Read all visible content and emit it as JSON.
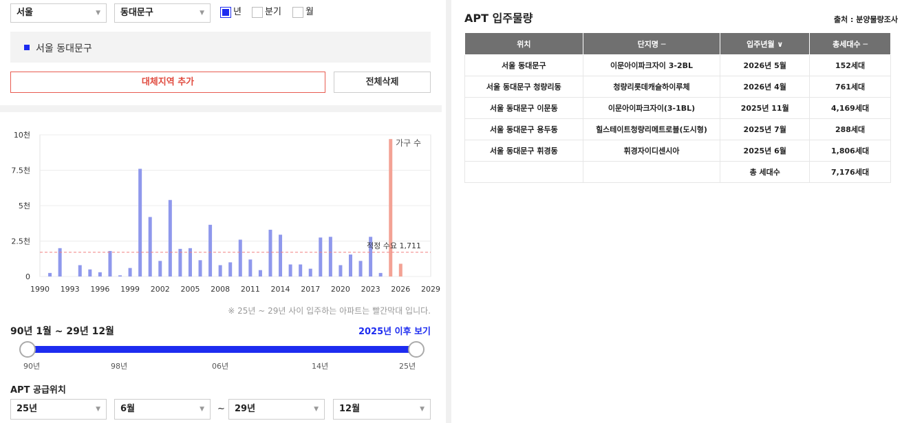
{
  "filters": {
    "city": "서울",
    "district": "동대문구",
    "periods": [
      {
        "label": "년",
        "checked": true
      },
      {
        "label": "분기",
        "checked": false
      },
      {
        "label": "월",
        "checked": false
      }
    ]
  },
  "region_panel": {
    "selected": "서울 동대문구"
  },
  "buttons": {
    "add_compare": "대체지역 추가",
    "delete_all": "전체삭제"
  },
  "chart_data": {
    "type": "bar",
    "y_unit_label": "가구 수",
    "ylim": [
      0,
      10000
    ],
    "y_ticks": [
      {
        "value": 0,
        "label": "0"
      },
      {
        "value": 2500,
        "label": "2.5천"
      },
      {
        "value": 5000,
        "label": "5천"
      },
      {
        "value": 7500,
        "label": "7.5천"
      },
      {
        "value": 10000,
        "label": "10천"
      }
    ],
    "x_ticks": [
      "1990",
      "1993",
      "1996",
      "1999",
      "2002",
      "2005",
      "2008",
      "2011",
      "2014",
      "2017",
      "2020",
      "2023",
      "2026",
      "2029"
    ],
    "xlim": [
      1990,
      2029
    ],
    "reference_line": {
      "value": 1711,
      "label": "적정 수요 1,711",
      "color": "#f08080"
    },
    "series_colors": {
      "past": "#8f98ec",
      "future": "#f3a295"
    },
    "bars": [
      {
        "year": 1991,
        "value": 250
      },
      {
        "year": 1992,
        "value": 2000
      },
      {
        "year": 1994,
        "value": 800
      },
      {
        "year": 1995,
        "value": 500
      },
      {
        "year": 1996,
        "value": 300
      },
      {
        "year": 1997,
        "value": 1800
      },
      {
        "year": 1998,
        "value": 80
      },
      {
        "year": 1999,
        "value": 600
      },
      {
        "year": 2000,
        "value": 7600
      },
      {
        "year": 2001,
        "value": 4200
      },
      {
        "year": 2002,
        "value": 1100
      },
      {
        "year": 2003,
        "value": 5400
      },
      {
        "year": 2004,
        "value": 1950
      },
      {
        "year": 2005,
        "value": 2000
      },
      {
        "year": 2006,
        "value": 1150
      },
      {
        "year": 2007,
        "value": 3650
      },
      {
        "year": 2008,
        "value": 800
      },
      {
        "year": 2009,
        "value": 1000
      },
      {
        "year": 2010,
        "value": 2600
      },
      {
        "year": 2011,
        "value": 1200
      },
      {
        "year": 2012,
        "value": 450
      },
      {
        "year": 2013,
        "value": 3300
      },
      {
        "year": 2014,
        "value": 2950
      },
      {
        "year": 2015,
        "value": 850
      },
      {
        "year": 2016,
        "value": 850
      },
      {
        "year": 2017,
        "value": 550
      },
      {
        "year": 2018,
        "value": 2750
      },
      {
        "year": 2019,
        "value": 2800
      },
      {
        "year": 2020,
        "value": 800
      },
      {
        "year": 2021,
        "value": 1550
      },
      {
        "year": 2022,
        "value": 1100
      },
      {
        "year": 2023,
        "value": 2800
      },
      {
        "year": 2024,
        "value": 250
      },
      {
        "year": 2025,
        "value": 9700,
        "future": true
      },
      {
        "year": 2026,
        "value": 900,
        "future": true
      }
    ]
  },
  "chart_note": "※ 25년 ~ 29년 사이 입주하는 아파트는 빨간막대 입니다.",
  "range": {
    "title": "90년 1월 ~ 29년 12월",
    "link": "2025년 이후 보기",
    "ticks": [
      "90년",
      "98년",
      "06년",
      "14년",
      "25년"
    ]
  },
  "supply": {
    "label": "APT 공급위치",
    "from_year": "25년",
    "from_month": "6월",
    "tilde": "~",
    "to_year": "29년",
    "to_month": "12월"
  },
  "table": {
    "title": "APT 입주물량",
    "source": "출처 : 분양물량조사",
    "headers": [
      "위치",
      "단지명 ─",
      "입주년월 ∨",
      "총세대수 ─"
    ],
    "rows": [
      [
        "서울 동대문구",
        "이문아이파크자이 3-2BL",
        "2026년 5월",
        "152세대"
      ],
      [
        "서울 동대문구 청량리동",
        "청량리롯데캐슬하이루체",
        "2026년 4월",
        "761세대"
      ],
      [
        "서울 동대문구 이문동",
        "이문아이파크자이(3-1BL)",
        "2025년 11월",
        "4,169세대"
      ],
      [
        "서울 동대문구 용두동",
        "힐스테이트청량리메트로블(도시형)",
        "2025년 7월",
        "288세대"
      ],
      [
        "서울 동대문구 휘경동",
        "휘경자이디센시아",
        "2025년 6월",
        "1,806세대"
      ]
    ],
    "total_label": "총 세대수",
    "total_value": "7,176세대"
  }
}
